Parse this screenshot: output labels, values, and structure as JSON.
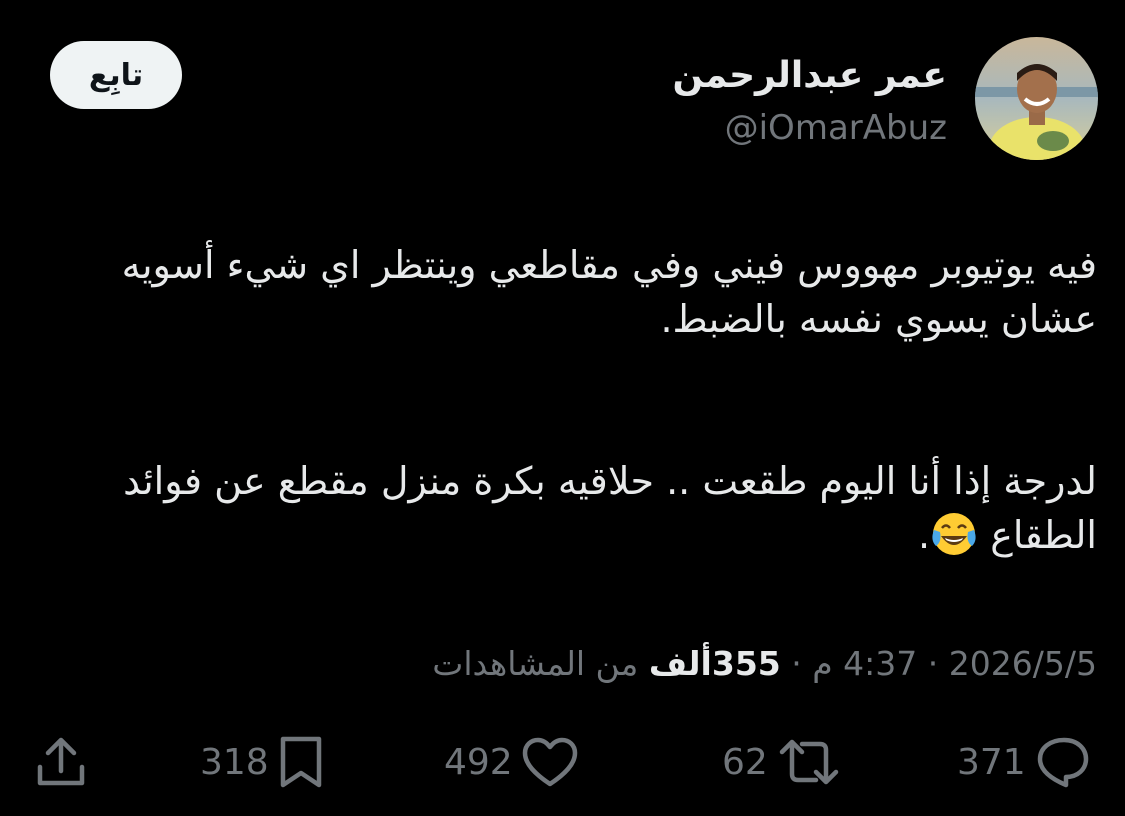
{
  "author": {
    "display_name": "عمر عبدالرحمن",
    "handle": "@iOmarAbuz",
    "avatar_icon": "profile-photo"
  },
  "follow_button": {
    "label": "تابِع"
  },
  "tweet": {
    "paragraph1": "فيه يوتيوبر مهووس فيني وفي مقاطعي وينتظر اي شيء أسويه عشان يسوي نفسه بالضبط.",
    "paragraph2": "لدرجة إذا أنا اليوم طقعت .. حلاقيه بكرة منزل مقطع عن فوائد الطقاع",
    "paragraph2_end": ".",
    "emoji": "face-with-tears-of-joy"
  },
  "meta": {
    "date": "2026/5/5",
    "separator": "·",
    "time": "4:37 م",
    "views_count": "355ألف",
    "views_label": "من المشاهدات"
  },
  "actions": {
    "replies": "371",
    "reposts": "62",
    "likes": "492",
    "bookmarks": "318"
  },
  "colors": {
    "background": "#000000",
    "text_primary": "#e7e9ea",
    "text_secondary": "#71767b",
    "follow_bg": "#eff3f4"
  }
}
